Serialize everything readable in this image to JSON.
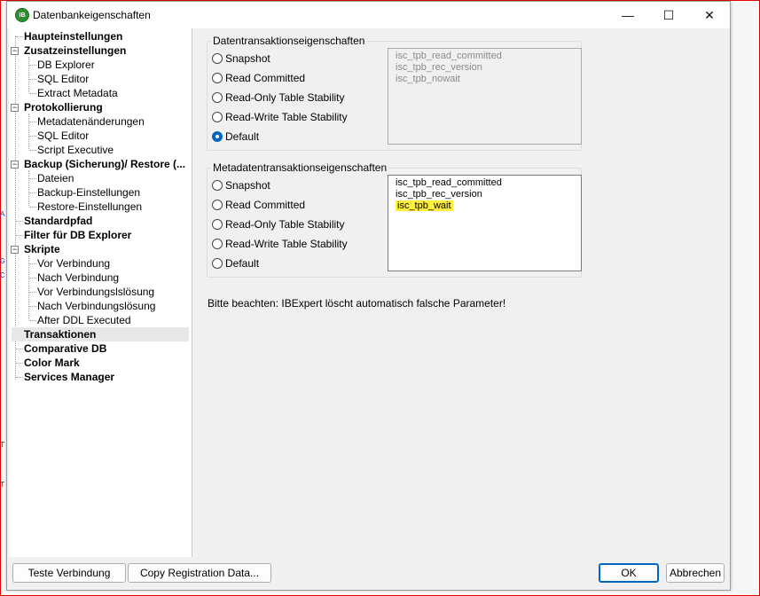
{
  "window": {
    "title": "Datenbankeigenschaften",
    "icon_label": "IB",
    "controls": {
      "minimize": "—",
      "maximize": "☐",
      "close": "✕"
    }
  },
  "tree": {
    "items": [
      {
        "label": "Haupteinstellungen",
        "level": 0
      },
      {
        "label": "Zusatzeinstellungen",
        "level": 0,
        "expanded": true
      },
      {
        "label": "DB Explorer",
        "level": 1
      },
      {
        "label": "SQL Editor",
        "level": 1
      },
      {
        "label": "Extract Metadata",
        "level": 1
      },
      {
        "label": "Protokollierung",
        "level": 0,
        "expanded": true
      },
      {
        "label": "Metadatenänderungen",
        "level": 1
      },
      {
        "label": "SQL Editor",
        "level": 1
      },
      {
        "label": "Script Executive",
        "level": 1
      },
      {
        "label": "Backup (Sicherung)/ Restore (...",
        "level": 0,
        "expanded": true
      },
      {
        "label": "Dateien",
        "level": 1
      },
      {
        "label": "Backup-Einstellungen",
        "level": 1
      },
      {
        "label": "Restore-Einstellungen",
        "level": 1
      },
      {
        "label": "Standardpfad",
        "level": 0
      },
      {
        "label": "Filter für DB Explorer",
        "level": 0
      },
      {
        "label": "Skripte",
        "level": 0,
        "expanded": true
      },
      {
        "label": "Vor Verbindung",
        "level": 1
      },
      {
        "label": "Nach Verbindung",
        "level": 1
      },
      {
        "label": "Vor Verbindungslslösung",
        "level": 1
      },
      {
        "label": "Nach Verbindungslösung",
        "level": 1
      },
      {
        "label": "After DDL Executed",
        "level": 1
      },
      {
        "label": "Transaktionen",
        "level": 0,
        "selected": true
      },
      {
        "label": "Comparative DB",
        "level": 0
      },
      {
        "label": "Color Mark",
        "level": 0
      },
      {
        "label": "Services Manager",
        "level": 0
      }
    ]
  },
  "data_transactions": {
    "title": "Datentransaktionseigenschaften",
    "options": [
      "Snapshot",
      "Read Committed",
      "Read-Only Table Stability",
      "Read-Write Table Stability",
      "Default"
    ],
    "selected": "Default",
    "params": [
      "isc_tpb_read_committed",
      "isc_tpb_rec_version",
      "isc_tpb_nowait"
    ]
  },
  "metadata_transactions": {
    "title": "Metadatentransaktionseigenschaften",
    "options": [
      "Snapshot",
      "Read Committed",
      "Read-Only Table Stability",
      "Read-Write Table Stability",
      "Default"
    ],
    "selected": null,
    "params": [
      "isc_tpb_read_committed",
      "isc_tpb_rec_version",
      "isc_tpb_wait"
    ],
    "highlighted_param": "isc_tpb_wait"
  },
  "note": "Bitte beachten: IBExpert löscht automatisch falsche Parameter!",
  "buttons": {
    "test_connection": "Teste Verbindung",
    "copy_registration": "Copy Registration Data...",
    "ok": "OK",
    "cancel": "Abbrechen"
  },
  "colors": {
    "accent": "#0067c0",
    "highlight": "#ffef3a",
    "frame": "#e00000"
  },
  "left_edge_marks": [
    "A",
    "G",
    "C",
    "T",
    "T"
  ]
}
